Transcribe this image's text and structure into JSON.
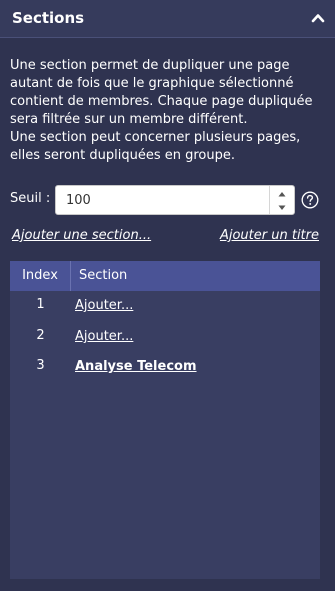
{
  "header": {
    "title": "Sections",
    "collapse_icon": "chevron-up-icon"
  },
  "description": "Une section permet de dupliquer une page\nautant de fois que le graphique sélectionné\ncontient de membres. Chaque page dupliquée\nsera filtrée sur un membre différent.\nUne section peut concerner plusieurs pages,\nelles seront dupliquées en groupe.",
  "seuil": {
    "label": "Seuil :",
    "value": "100",
    "help_icon": "help-circle-icon"
  },
  "links": {
    "add_section": "Ajouter une section...",
    "add_title": "Ajouter un titre"
  },
  "table": {
    "headers": {
      "index": "Index",
      "section": "Section"
    },
    "rows": [
      {
        "index": "1",
        "section": "Ajouter..."
      },
      {
        "index": "2",
        "section": "Ajouter..."
      },
      {
        "index": "3",
        "section": "Analyse Telecom"
      }
    ]
  },
  "colors": {
    "background": "#2f3350",
    "header_bg": "#363b5c",
    "table_bg": "#393e62",
    "table_header_bg": "#4a5396"
  }
}
